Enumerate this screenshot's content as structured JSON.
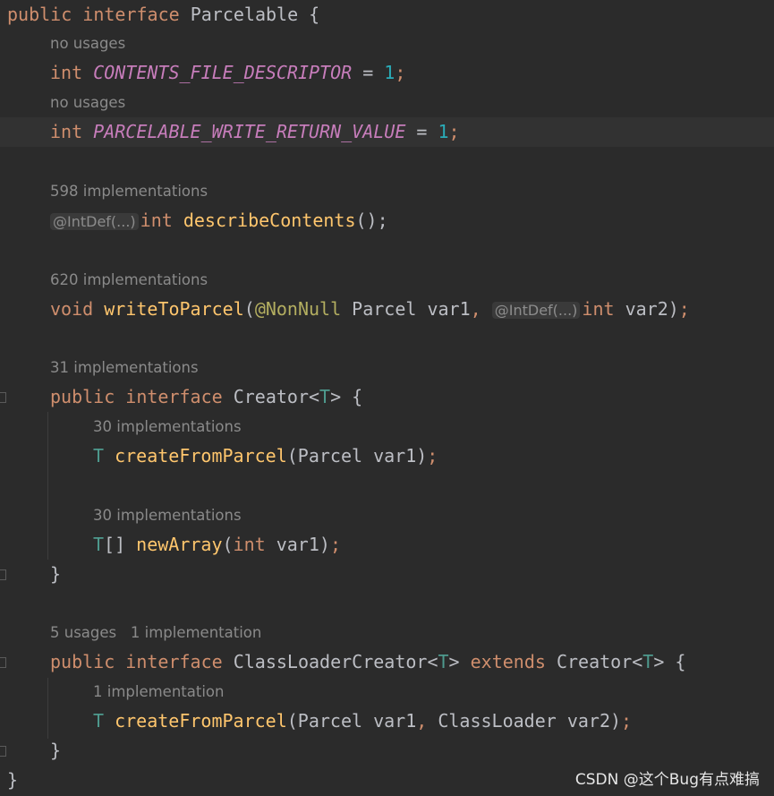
{
  "editor": {
    "lines": [
      {
        "indent": 0,
        "tokens": [
          {
            "t": "public ",
            "c": "kw"
          },
          {
            "t": "interface ",
            "c": "kw"
          },
          {
            "t": "Parcelable {",
            "c": "txt"
          }
        ]
      },
      {
        "indent": 1,
        "hint": "no usages"
      },
      {
        "indent": 1,
        "tokens": [
          {
            "t": "int ",
            "c": "kw"
          },
          {
            "t": "CONTENTS_FILE_DESCRIPTOR",
            "c": "const"
          },
          {
            "t": " = ",
            "c": "txt"
          },
          {
            "t": "1",
            "c": "num"
          },
          {
            "t": ";",
            "c": "punc"
          }
        ]
      },
      {
        "indent": 1,
        "hint": "no usages"
      },
      {
        "indent": 1,
        "current": true,
        "tokens": [
          {
            "t": "int ",
            "c": "kw"
          },
          {
            "t": "PARCELABLE_WRITE_RETURN_VALUE",
            "c": "const"
          },
          {
            "t": " = ",
            "c": "txt"
          },
          {
            "t": "1",
            "c": "num"
          },
          {
            "t": ";",
            "c": "punc"
          }
        ]
      },
      {
        "indent": 0,
        "tokens": []
      },
      {
        "indent": 1,
        "hint": "598 implementations"
      },
      {
        "indent": 1,
        "tokens": [
          {
            "t": "@IntDef(...)",
            "c": "ihint"
          },
          {
            "t": "int ",
            "c": "kw"
          },
          {
            "t": "describeContents",
            "c": "fn"
          },
          {
            "t": "();",
            "c": "txt"
          }
        ]
      },
      {
        "indent": 0,
        "tokens": []
      },
      {
        "indent": 1,
        "hint": "620 implementations"
      },
      {
        "indent": 1,
        "tokens": [
          {
            "t": "void ",
            "c": "kw"
          },
          {
            "t": "writeToParcel",
            "c": "fn"
          },
          {
            "t": "(",
            "c": "txt"
          },
          {
            "t": "@NonNull",
            "c": "ann"
          },
          {
            "t": " Parcel var1",
            "c": "txt"
          },
          {
            "t": ", ",
            "c": "punc"
          },
          {
            "t": "@IntDef(...)",
            "c": "ihint"
          },
          {
            "t": "int ",
            "c": "kw"
          },
          {
            "t": "var2)",
            "c": "txt"
          },
          {
            "t": ";",
            "c": "punc"
          }
        ]
      },
      {
        "indent": 0,
        "tokens": []
      },
      {
        "indent": 1,
        "hint": "31 implementations"
      },
      {
        "indent": 1,
        "fold": true,
        "tokens": [
          {
            "t": "public ",
            "c": "kw"
          },
          {
            "t": "interface ",
            "c": "kw"
          },
          {
            "t": "Creator<",
            "c": "txt"
          },
          {
            "t": "T",
            "c": "tp"
          },
          {
            "t": "> {",
            "c": "txt"
          }
        ]
      },
      {
        "indent": 2,
        "hint": "30 implementations"
      },
      {
        "indent": 2,
        "tokens": [
          {
            "t": "T ",
            "c": "tp"
          },
          {
            "t": "createFromParcel",
            "c": "fn"
          },
          {
            "t": "(Parcel var1)",
            "c": "txt"
          },
          {
            "t": ";",
            "c": "punc"
          }
        ]
      },
      {
        "indent": 0,
        "tokens": []
      },
      {
        "indent": 2,
        "hint": "30 implementations"
      },
      {
        "indent": 2,
        "tokens": [
          {
            "t": "T",
            "c": "tp"
          },
          {
            "t": "[] ",
            "c": "txt"
          },
          {
            "t": "newArray",
            "c": "fn"
          },
          {
            "t": "(",
            "c": "txt"
          },
          {
            "t": "int ",
            "c": "kw"
          },
          {
            "t": "var1)",
            "c": "txt"
          },
          {
            "t": ";",
            "c": "punc"
          }
        ]
      },
      {
        "indent": 1,
        "fold": true,
        "tokens": [
          {
            "t": "}",
            "c": "txt"
          }
        ]
      },
      {
        "indent": 0,
        "tokens": []
      },
      {
        "indent": 1,
        "hint": "5 usages   1 implementation"
      },
      {
        "indent": 1,
        "fold": true,
        "tokens": [
          {
            "t": "public ",
            "c": "kw"
          },
          {
            "t": "interface ",
            "c": "kw"
          },
          {
            "t": "ClassLoaderCreator<",
            "c": "txt"
          },
          {
            "t": "T",
            "c": "tp"
          },
          {
            "t": "> ",
            "c": "txt"
          },
          {
            "t": "extends ",
            "c": "kw"
          },
          {
            "t": "Creator<",
            "c": "txt"
          },
          {
            "t": "T",
            "c": "tp"
          },
          {
            "t": "> {",
            "c": "txt"
          }
        ]
      },
      {
        "indent": 2,
        "hint": "1 implementation"
      },
      {
        "indent": 2,
        "tokens": [
          {
            "t": "T ",
            "c": "tp"
          },
          {
            "t": "createFromParcel",
            "c": "fn"
          },
          {
            "t": "(Parcel var1",
            "c": "txt"
          },
          {
            "t": ", ",
            "c": "punc"
          },
          {
            "t": "ClassLoader var2)",
            "c": "txt"
          },
          {
            "t": ";",
            "c": "punc"
          }
        ]
      },
      {
        "indent": 1,
        "fold": true,
        "tokens": [
          {
            "t": "}",
            "c": "txt"
          }
        ]
      },
      {
        "indent": 0,
        "tokens": [
          {
            "t": "}",
            "c": "txt"
          }
        ]
      }
    ]
  },
  "watermark": "CSDN @这个Bug有点难搞"
}
